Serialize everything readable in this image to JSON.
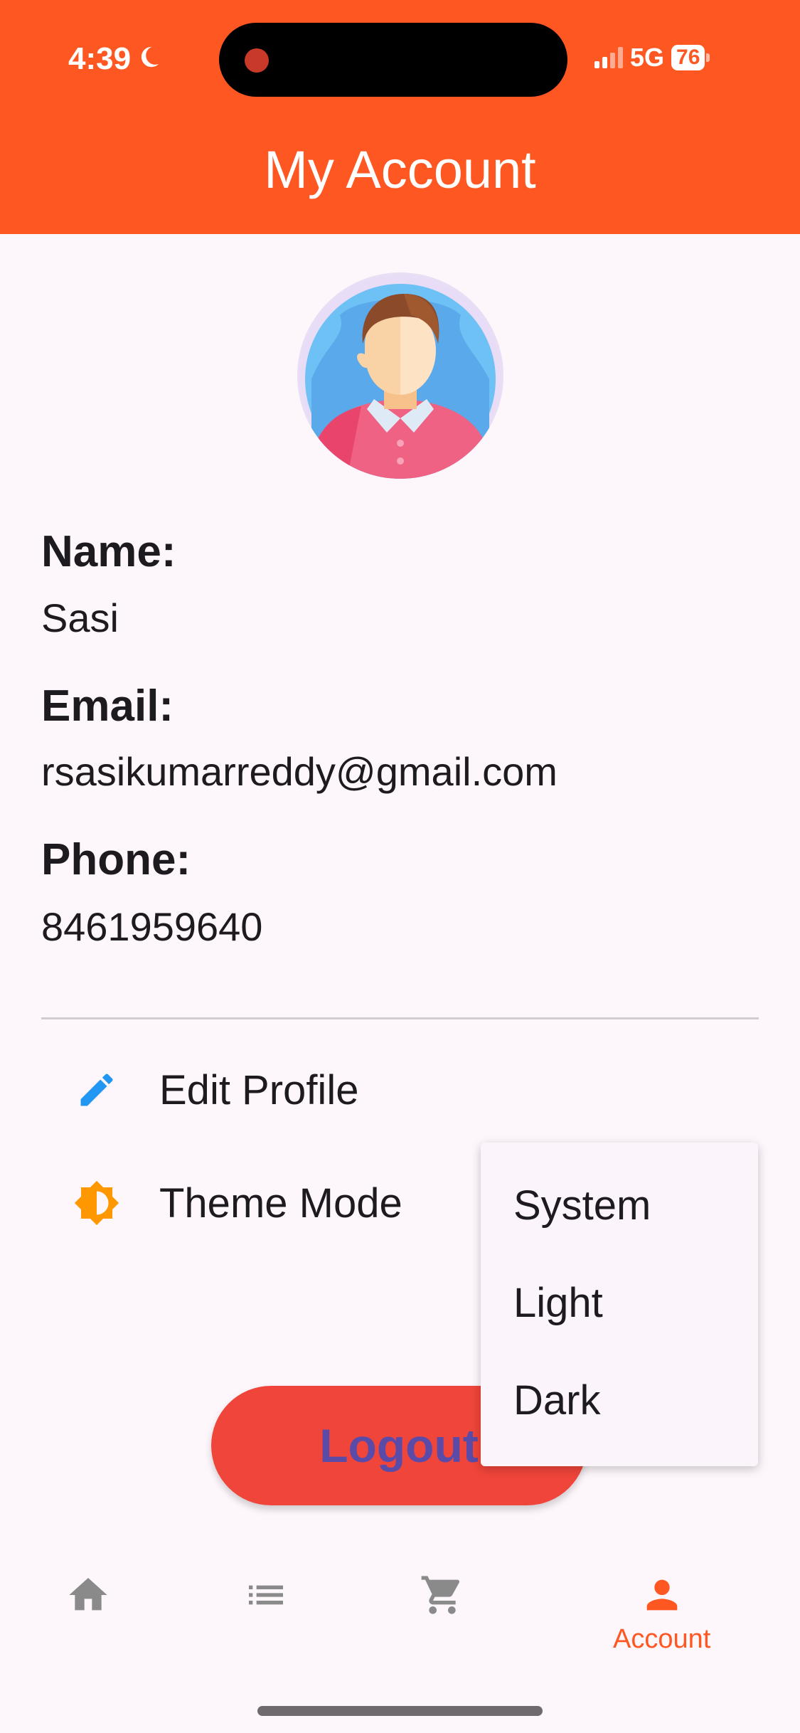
{
  "status_bar": {
    "time": "4:39",
    "network": "5G",
    "battery": "76"
  },
  "header": {
    "title": "My Account"
  },
  "profile": {
    "name_label": "Name:",
    "name_value": "Sasi",
    "email_label": "Email:",
    "email_value": "rsasikumarreddy@gmail.com",
    "phone_label": "Phone:",
    "phone_value": "8461959640"
  },
  "menu": {
    "edit_profile": "Edit Profile",
    "theme_mode": "Theme Mode"
  },
  "theme_popup": {
    "options": [
      "System",
      "Light",
      "Dark"
    ]
  },
  "logout": {
    "label": "Logout"
  },
  "bottom_nav": {
    "items": [
      {
        "icon": "home-icon",
        "label": ""
      },
      {
        "icon": "list-icon",
        "label": ""
      },
      {
        "icon": "cart-icon",
        "label": ""
      },
      {
        "icon": "person-icon",
        "label": "Account"
      }
    ],
    "active_color": "#ff5722",
    "inactive_color": "#8a8a8a"
  },
  "colors": {
    "primary": "#ff5722",
    "logout": "#f0453a",
    "edit_icon": "#2196f3",
    "theme_icon": "#ff9800"
  }
}
